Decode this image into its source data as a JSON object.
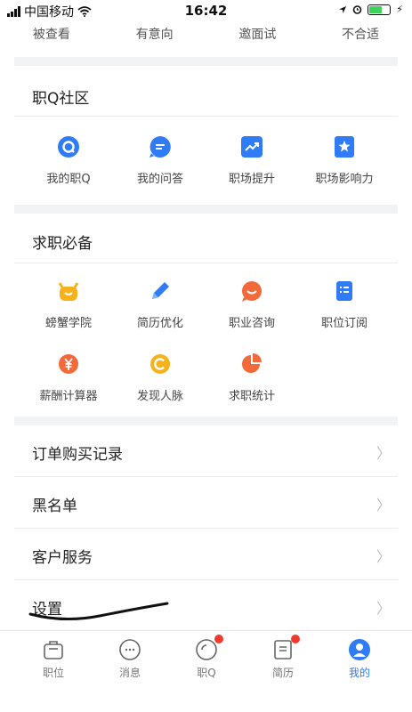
{
  "status_bar": {
    "carrier": "中国移动",
    "time": "16:42"
  },
  "top_tabs": [
    "被查看",
    "有意向",
    "邀面试",
    "不合适"
  ],
  "community": {
    "title": "职Q社区",
    "items": [
      {
        "label": "我的职Q",
        "icon": "my-zhiq-icon"
      },
      {
        "label": "我的问答",
        "icon": "qa-chat-icon"
      },
      {
        "label": "职场提升",
        "icon": "trend-up-icon"
      },
      {
        "label": "职场影响力",
        "icon": "star-badge-icon"
      }
    ]
  },
  "job_essentials": {
    "title": "求职必备",
    "items": [
      {
        "label": "螃蟹学院",
        "icon": "crab-icon"
      },
      {
        "label": "简历优化",
        "icon": "pencil-icon"
      },
      {
        "label": "职业咨询",
        "icon": "consult-icon"
      },
      {
        "label": "职位订阅",
        "icon": "subscription-icon"
      },
      {
        "label": "薪酬计算器",
        "icon": "yuan-icon"
      },
      {
        "label": "发现人脉",
        "icon": "connections-icon"
      },
      {
        "label": "求职统计",
        "icon": "pie-chart-icon"
      }
    ]
  },
  "menu_list": [
    "订单购买记录",
    "黑名单",
    "客户服务",
    "设置"
  ],
  "tab_bar": [
    {
      "label": "职位",
      "icon": "briefcase-icon",
      "badge": false,
      "active": false
    },
    {
      "label": "消息",
      "icon": "message-icon",
      "badge": false,
      "active": false
    },
    {
      "label": "职Q",
      "icon": "zhiq-icon",
      "badge": true,
      "active": false
    },
    {
      "label": "简历",
      "icon": "resume-icon",
      "badge": true,
      "active": false
    },
    {
      "label": "我的",
      "icon": "profile-icon",
      "badge": false,
      "active": true
    }
  ],
  "colors": {
    "blue": "#2f7cf6",
    "yellow": "#f6b21c",
    "orange": "#f26a3a",
    "badge_red": "#f03a2e"
  }
}
